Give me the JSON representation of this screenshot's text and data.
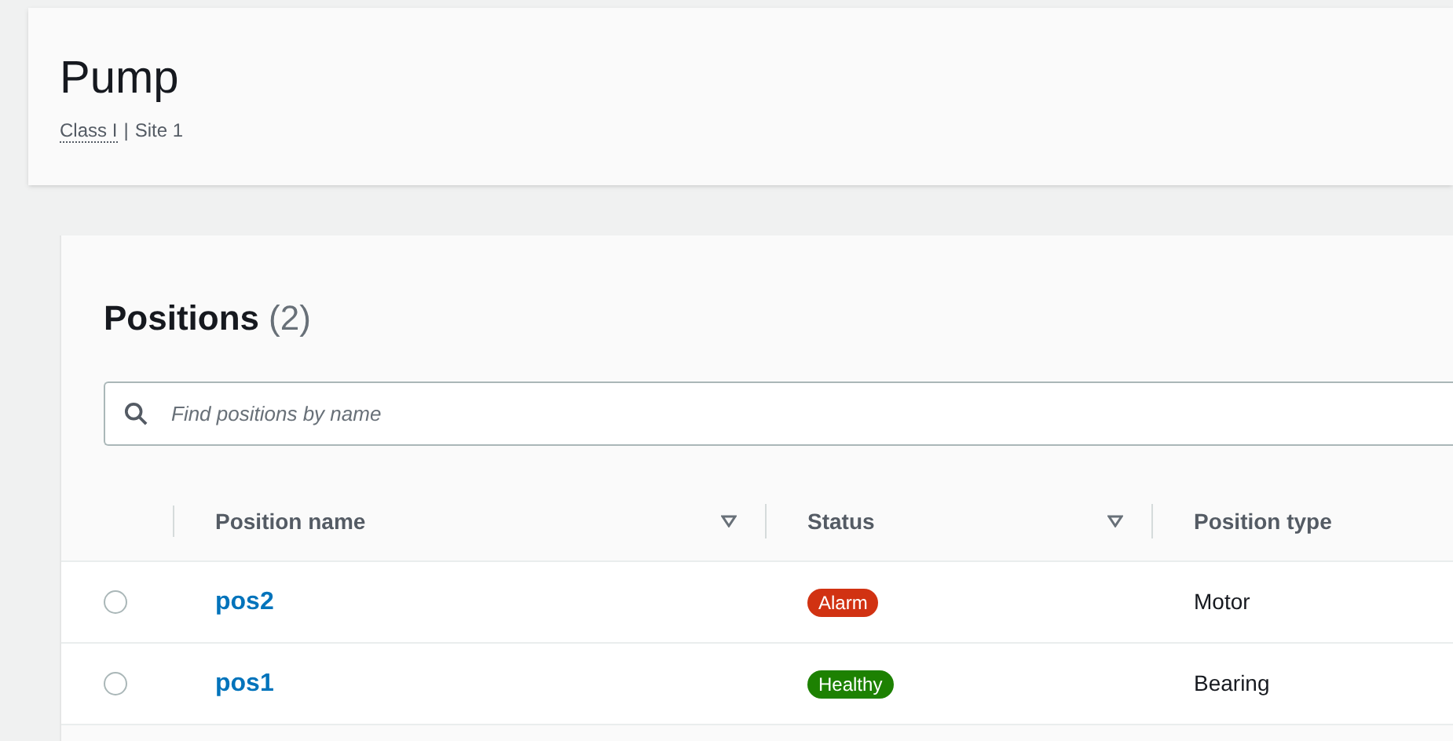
{
  "header": {
    "title": "Pump",
    "subtitle_link": "Class I",
    "subtitle_separator": "|",
    "subtitle_rest": "Site 1"
  },
  "positions": {
    "title": "Positions",
    "count": "(2)",
    "search": {
      "placeholder": "Find positions by name"
    },
    "columns": [
      {
        "label": "Position name",
        "sortable": true
      },
      {
        "label": "Status",
        "sortable": true
      },
      {
        "label": "Position type",
        "sortable": false
      }
    ],
    "rows": [
      {
        "selected": false,
        "name": "pos2",
        "status": "Alarm",
        "color": "#d13212",
        "type": "Motor"
      },
      {
        "selected": false,
        "name": "pos1",
        "status": "Healthy",
        "color": "#1d8102",
        "type": "Bearing"
      }
    ]
  }
}
